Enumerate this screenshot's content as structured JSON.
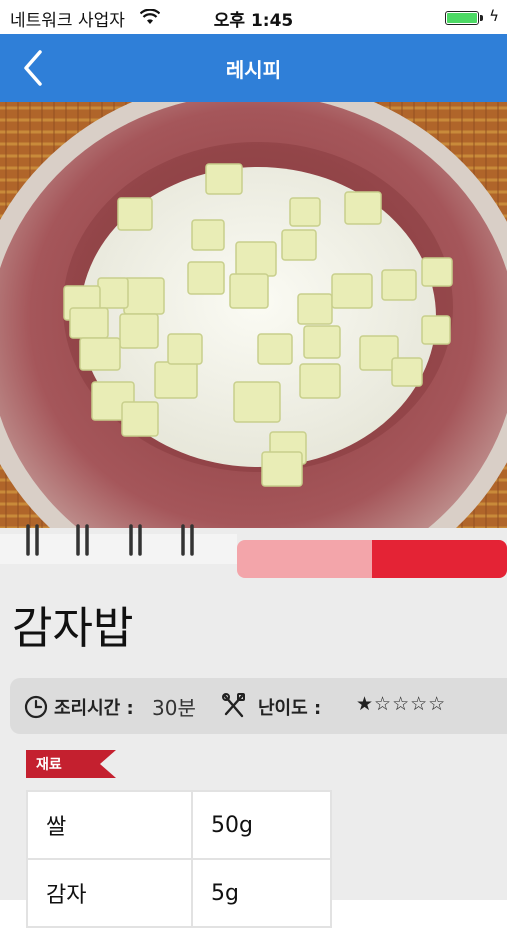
{
  "status": {
    "carrier": "네트워크 사업자",
    "time": "오후 1:45",
    "battery_color": "#4cd964"
  },
  "nav": {
    "title": "레시피",
    "back_icon": "chevron-left-icon",
    "color": "#2f7fd8"
  },
  "recipe": {
    "title": "감자밥",
    "cook_time_label": "조리시간 :",
    "cook_time_value": "30분",
    "difficulty_label": "난이도 :",
    "difficulty_stars": "★☆☆☆☆",
    "difficulty_rating": 1,
    "difficulty_max": 5
  },
  "ingredients": {
    "tag_label": "재료",
    "rows": [
      {
        "name": "쌀",
        "amount": "50g"
      },
      {
        "name": "감자",
        "amount": "5g"
      }
    ]
  },
  "colors": {
    "accent_red": "#e42335",
    "accent_pink": "#f3a5aa"
  }
}
